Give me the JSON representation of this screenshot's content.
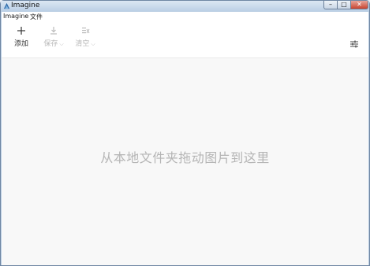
{
  "window": {
    "title": "Imagine"
  },
  "menu": {
    "items": [
      "Imagine",
      "文件"
    ]
  },
  "toolbar": {
    "add": {
      "label": "添加",
      "icon": "plus-icon"
    },
    "save": {
      "label": "保存",
      "icon": "download-icon"
    },
    "clear": {
      "label": "清空",
      "icon": "clear-icon"
    },
    "settings_icon": "sliders-icon"
  },
  "main": {
    "hint": "从本地文件夹拖动图片到这里"
  },
  "colors": {
    "title_bar": "#bcd0e6",
    "close_button": "#c8442f",
    "hint_text": "#b5b5b5"
  }
}
